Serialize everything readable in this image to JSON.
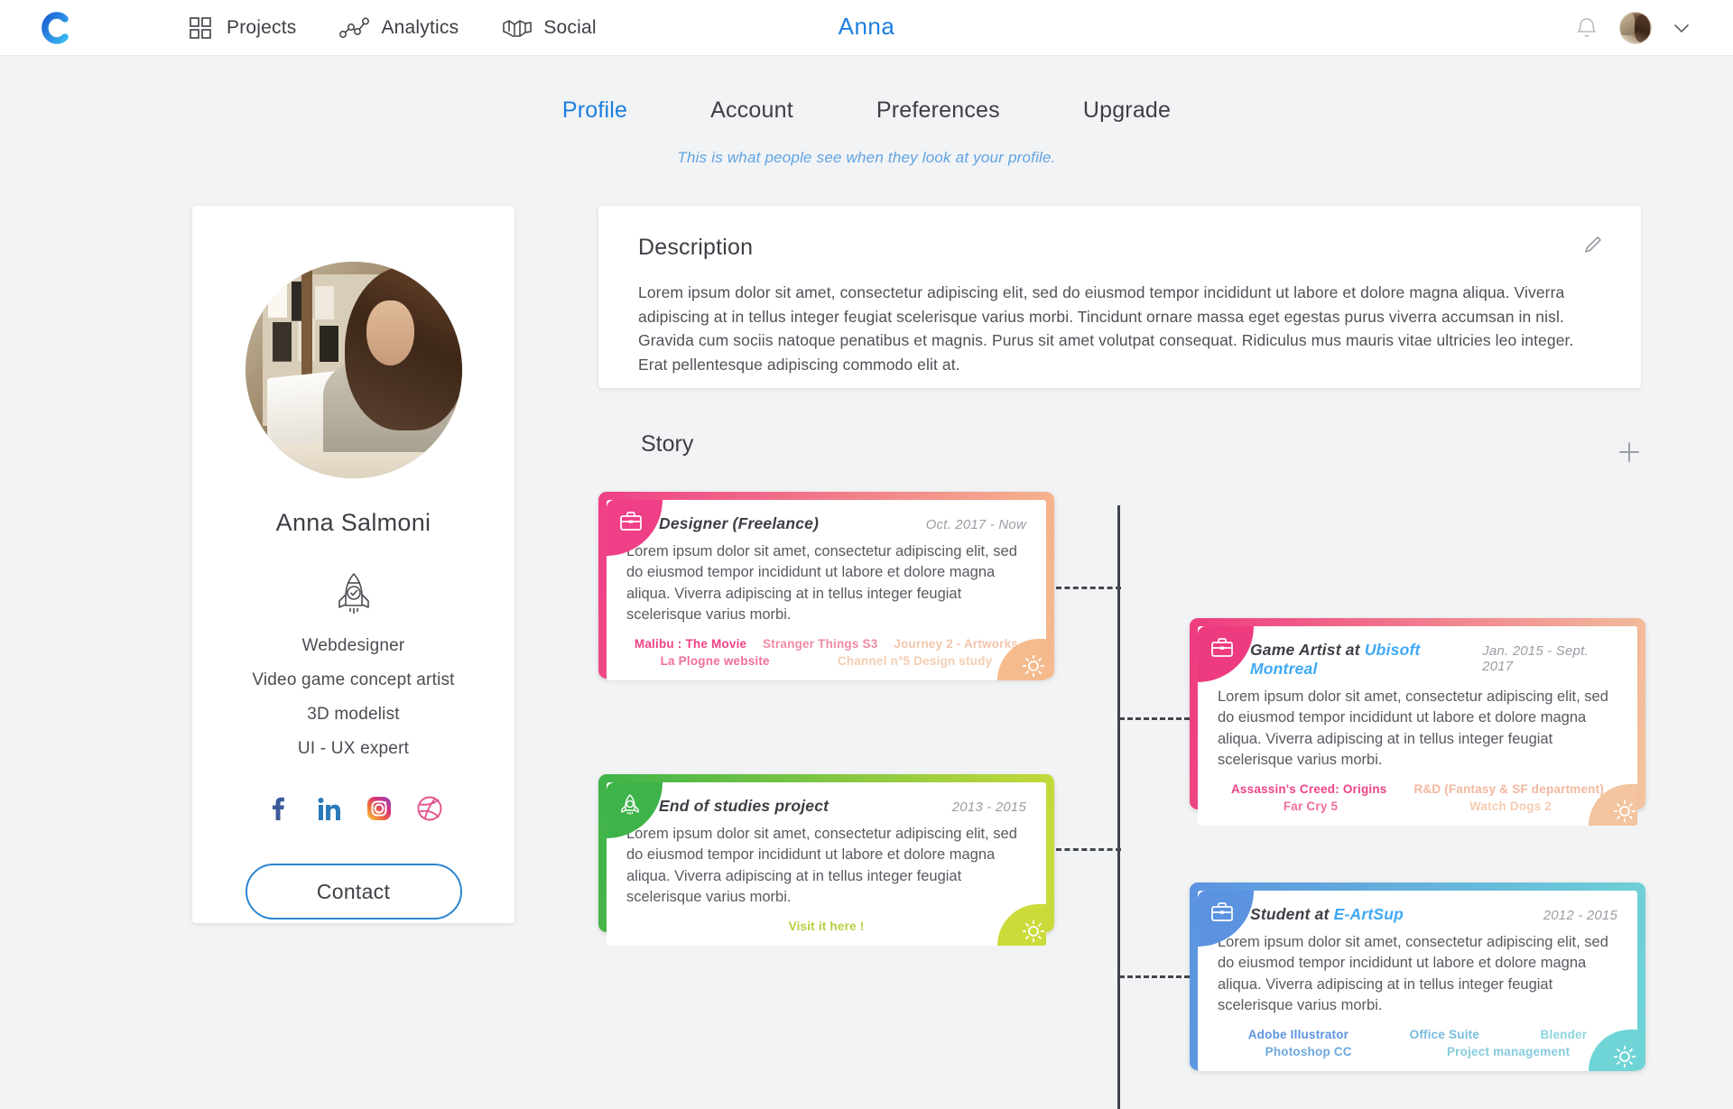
{
  "nav": {
    "logo": "c-logo",
    "items": [
      {
        "label": "Projects",
        "icon": "grid-icon"
      },
      {
        "label": "Analytics",
        "icon": "graph-nodes-icon"
      },
      {
        "label": "Social",
        "icon": "handshake-icon"
      }
    ],
    "title": "Anna",
    "bell": "bell-icon",
    "chevron": "chevron-down-icon"
  },
  "tabs": {
    "items": [
      "Profile",
      "Account",
      "Preferences",
      "Upgrade"
    ],
    "active": "Profile",
    "subtitle": "This is what people see when they look at your profile."
  },
  "profile": {
    "name": "Anna Salmoni",
    "badge_icon": "rocket-icon",
    "roles": [
      "Webdesigner",
      "Video game concept artist",
      "3D modelist",
      "UI - UX expert"
    ],
    "socials": [
      {
        "name": "facebook-icon",
        "color": "#3b5a9a"
      },
      {
        "name": "linkedin-icon",
        "color": "#2a7ab9"
      },
      {
        "name": "instagram-icon",
        "color": "#d6317c"
      },
      {
        "name": "dribbble-icon",
        "color": "#e3538c"
      }
    ],
    "contact_label": "Contact"
  },
  "description": {
    "title": "Description",
    "edit_icon": "pencil-icon",
    "body": "Lorem ipsum dolor sit amet, consectetur adipiscing elit, sed do eiusmod tempor incididunt ut labore et dolore magna aliqua. Viverra adipiscing at in tellus integer feugiat scelerisque varius morbi. Tincidunt ornare massa eget egestas purus viverra accumsan in nisl. Gravida cum sociis natoque penatibus et magnis. Purus sit amet volutpat consequat. Ridiculus mus mauris vitae ultricies leo integer. Erat pellentesque adipiscing commodo elit at."
  },
  "story": {
    "title": "Story",
    "add_icon": "plus-icon",
    "cards": [
      {
        "id": "designer-freelance",
        "icon": "briefcase-icon",
        "title": "Designer (Freelance)",
        "org": "",
        "date": "Oct. 2017 - Now",
        "body": "Lorem ipsum dolor sit amet, consectetur adipiscing elit, sed do eiusmod tempor incididunt ut labore et dolore magna aliqua. Viverra adipiscing at in tellus integer feugiat scelerisque varius morbi.",
        "gradient_from": "#ef3f87",
        "gradient_to": "#f5bb8d",
        "tag_colors": [
          "#ee4387",
          "#f08ba4",
          "#f3c6ae",
          "#ef6f95",
          "#f4cdb2"
        ],
        "tags_row1": [
          "Malibu : The Movie",
          "Stranger Things S3",
          "Journey 2 - Artworks"
        ],
        "tags_row2": [
          "La Plogne website",
          "Channel n°5 Design study"
        ],
        "gear_icon": "gear-icon"
      },
      {
        "id": "game-artist-ubisoft",
        "icon": "briefcase-icon",
        "title": "Game Artist at ",
        "org": "Ubisoft Montreal",
        "org_color": "#3fa9f5",
        "date": "Jan. 2015 - Sept. 2017",
        "body": "Lorem ipsum dolor sit amet, consectetur adipiscing elit, sed do eiusmod tempor incididunt ut labore et dolore magna aliqua. Viverra adipiscing at in tellus integer feugiat scelerisque varius morbi.",
        "gradient_from": "#ee3b80",
        "gradient_to": "#f3c49d",
        "tag_colors": [
          "#ee4387",
          "#f3b79f",
          "#ef6f95",
          "#f4cdb2"
        ],
        "tags_row1": [
          "Assassin's Creed: Origins",
          "R&D (Fantasy & SF department)"
        ],
        "tags_row2": [
          "Far Cry 5",
          "Watch Dogs 2"
        ],
        "gear_icon": "gear-icon"
      },
      {
        "id": "end-of-studies",
        "icon": "rocket-icon",
        "title": "End of studies project",
        "org": "",
        "date": "2013 - 2015",
        "body": "Lorem ipsum dolor sit amet, consectetur adipiscing elit, sed do eiusmod tempor incididunt ut labore et dolore magna aliqua. Viverra adipiscing at in tellus integer feugiat scelerisque varius morbi.",
        "gradient_from": "#3eb34a",
        "gradient_to": "#cbdb3a",
        "tag_colors": [
          "#b6cf3e"
        ],
        "tags_row1": [],
        "tags_row2": [
          "Visit it here !"
        ],
        "gear_icon": "gear-icon"
      },
      {
        "id": "student-eartsup",
        "icon": "briefcase-icon",
        "title": "Student at ",
        "org": "E-ArtSup",
        "org_color": "#3fa9f5",
        "date": "2012 - 2015",
        "body": "Lorem ipsum dolor sit amet, consectetur adipiscing elit, sed do eiusmod tempor incididunt ut labore et dolore magna aliqua. Viverra adipiscing at in tellus integer feugiat scelerisque varius morbi.",
        "gradient_from": "#5b93e0",
        "gradient_to": "#6fd4d6",
        "tag_colors": [
          "#5b93e0",
          "#76bcdd",
          "#8ed4dd",
          "#6fa8dc",
          "#86cbdc"
        ],
        "tags_row1": [
          "Adobe Illustrator",
          "Office Suite",
          "Blender"
        ],
        "tags_row2": [
          "Photoshop CC",
          "Project management"
        ],
        "gear_icon": "gear-icon"
      }
    ]
  },
  "colors": {
    "page_bg": "#f2f3f4",
    "accent_blue": "#1c7fe0",
    "text_dark": "#3d3f45",
    "timeline": "#3f414c"
  }
}
